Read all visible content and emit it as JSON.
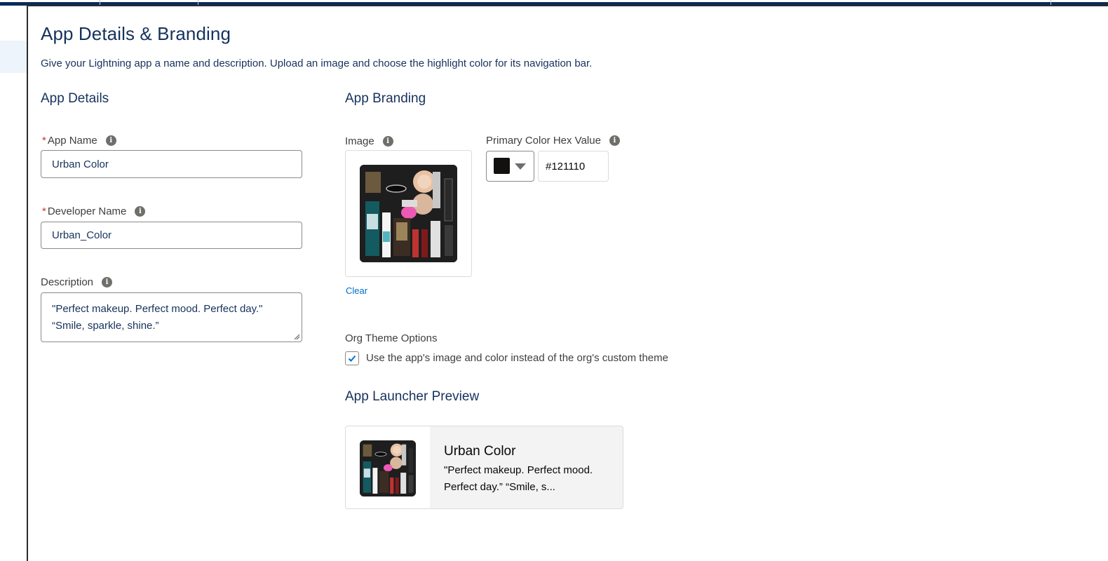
{
  "header": {
    "title": "App Details & Branding",
    "subtitle": "Give your Lightning app a name and description. Upload an image and choose the highlight color for its navigation bar."
  },
  "app_details": {
    "heading": "App Details",
    "app_name": {
      "label": "App Name",
      "required": true,
      "value": "Urban Color"
    },
    "developer_name": {
      "label": "Developer Name",
      "required": true,
      "value": "Urban_Color"
    },
    "description": {
      "label": "Description",
      "line1": "\"Perfect makeup. Perfect mood. Perfect day.\"",
      "line2": "“Smile, sparkle, shine.”"
    }
  },
  "app_branding": {
    "heading": "App Branding",
    "image_label": "Image",
    "clear_link": "Clear",
    "color_label": "Primary Color Hex Value",
    "color_value": "#121110",
    "org_theme_label": "Org Theme Options",
    "org_theme_checkbox_label": "Use the app's image and color instead of the org's custom theme",
    "org_theme_checked": true
  },
  "preview": {
    "heading": "App Launcher Preview",
    "name": "Urban Color",
    "desc_line1": "\"Perfect makeup. Perfect mood.",
    "desc_line2": "Perfect day.” “Smile, s..."
  },
  "icons": {
    "info": "info-icon",
    "required": "*",
    "check": "checkmark-icon",
    "caret": "chevron-down-icon"
  },
  "colors": {
    "brand_navy": "#16325c",
    "link": "#006dcc",
    "required": "#c23934",
    "swatch": "#121110"
  }
}
